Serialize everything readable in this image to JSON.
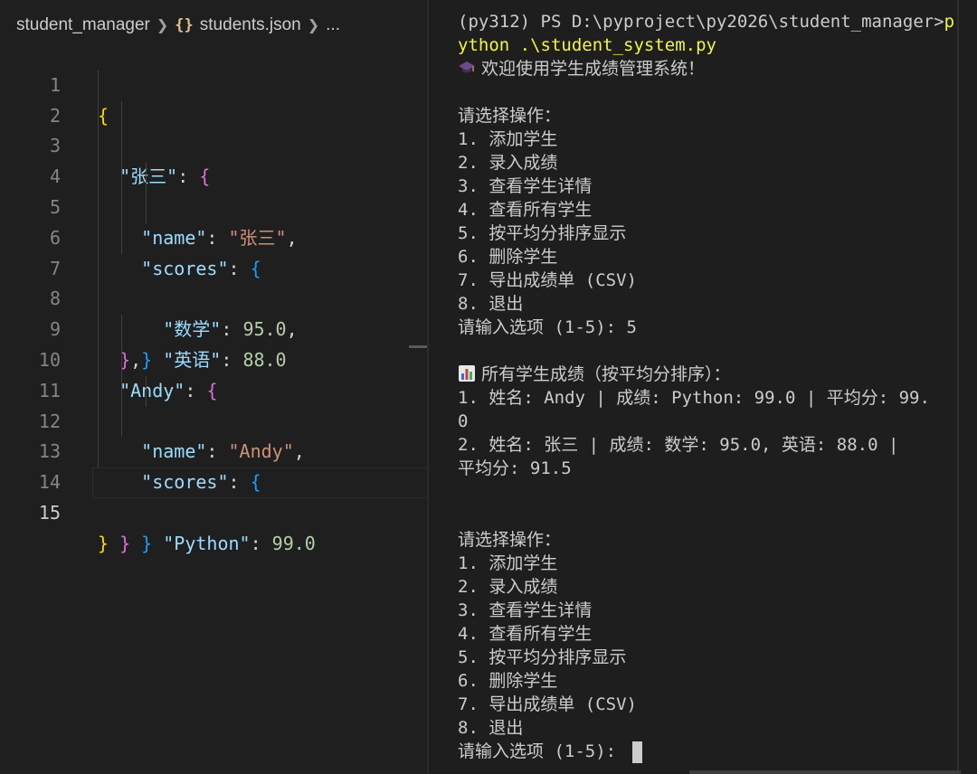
{
  "breadcrumb": {
    "folder": "student_manager",
    "sep": ">",
    "file_icon": "{}",
    "file": "students.json",
    "ellipsis": "..."
  },
  "editor": {
    "current_line": 15,
    "lines": [
      {
        "n": "1"
      },
      {
        "n": "2"
      },
      {
        "n": "3"
      },
      {
        "n": "4"
      },
      {
        "n": "5"
      },
      {
        "n": "6"
      },
      {
        "n": "7"
      },
      {
        "n": "8"
      },
      {
        "n": "9"
      },
      {
        "n": "10"
      },
      {
        "n": "11"
      },
      {
        "n": "12"
      },
      {
        "n": "13"
      },
      {
        "n": "14"
      },
      {
        "n": "15"
      }
    ],
    "tokens": {
      "l1": "{",
      "l2_key": "\"张三\"",
      "l2_colon": ": ",
      "l2_brace": "{",
      "l3_key": "\"name\"",
      "l3_colon": ": ",
      "l3_val": "\"张三\"",
      "l3_comma": ",",
      "l4_key": "\"scores\"",
      "l4_colon": ": ",
      "l4_brace": "{",
      "l5_key": "\"数学\"",
      "l5_colon": ": ",
      "l5_val": "95.0",
      "l5_comma": ",",
      "l6_key": "\"英语\"",
      "l6_colon": ": ",
      "l6_val": "88.0",
      "l7": "}",
      "l8_brace": "}",
      "l8_comma": ",",
      "l9_key": "\"Andy\"",
      "l9_colon": ": ",
      "l9_brace": "{",
      "l10_key": "\"name\"",
      "l10_colon": ": ",
      "l10_val": "\"Andy\"",
      "l10_comma": ",",
      "l11_key": "\"scores\"",
      "l11_colon": ": ",
      "l11_brace": "{",
      "l12_key": "\"Python\"",
      "l12_colon": ": ",
      "l12_val": "99.0",
      "l13": "}",
      "l14": "}",
      "l15": "}"
    }
  },
  "terminal": {
    "prompt": "(py312) PS D:\\pyproject\\py2026\\student_manager>",
    "cmd_first": "p",
    "cmd_rest": "ython .\\student_system.py",
    "welcome": "欢迎使用学生成绩管理系统！",
    "menu_title": "请选择操作：",
    "menu": [
      "1. 添加学生",
      "2. 录入成绩",
      "3. 查看学生详情",
      "4. 查看所有学生",
      "5. 按平均分排序显示",
      "6. 删除学生",
      "7. 导出成绩单 (CSV)",
      "8. 退出"
    ],
    "input_prompt": "请输入选项 (1-5): ",
    "input_value": "5",
    "result_title": "所有学生成绩（按平均分排序）：",
    "result_lines": [
      "1. 姓名: Andy | 成绩: Python: 99.0 | 平均分: 99.",
      "0",
      "2. 姓名: 张三 | 成绩: 数学: 95.0, 英语: 88.0 |",
      "平均分: 91.5"
    ],
    "menu_title_2": "请选择操作：",
    "input_prompt_2": "请输入选项 (1-5): "
  }
}
